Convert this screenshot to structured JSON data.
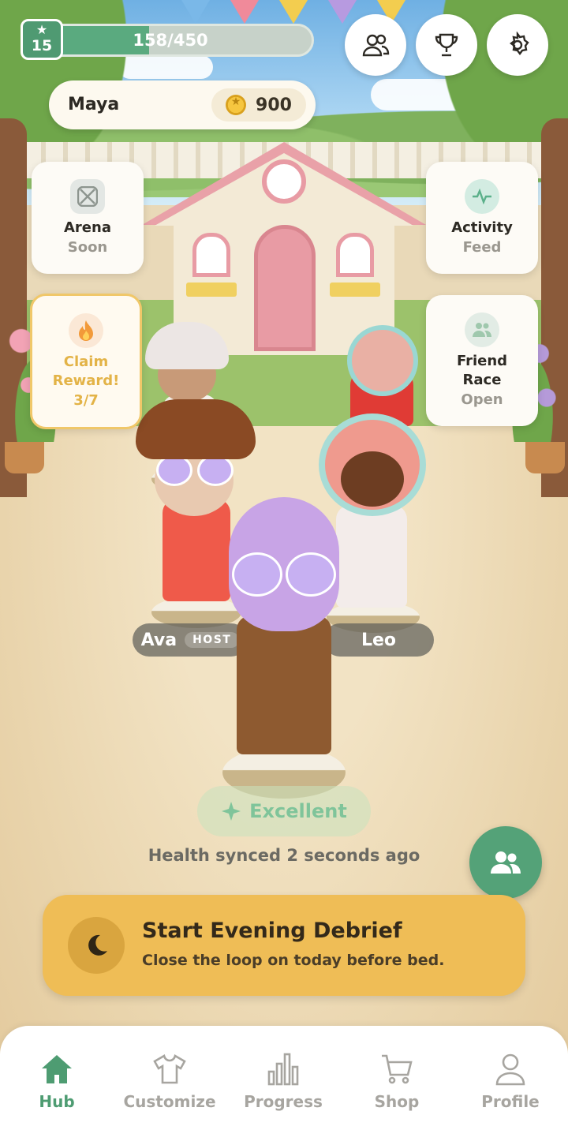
{
  "hud": {
    "level": "15",
    "xp_text": "158/450",
    "xp_progress": 0.351,
    "player_name": "Maya",
    "coins": "900"
  },
  "top_buttons": [
    {
      "icon": "friends-icon"
    },
    {
      "icon": "trophy-icon"
    },
    {
      "icon": "gear-icon"
    }
  ],
  "features": {
    "arena": {
      "title": "Arena",
      "status": "Soon",
      "icon": "crossed-swords-icon"
    },
    "activity": {
      "title": "Activity",
      "status": "Feed",
      "icon": "pulse-icon"
    },
    "reward": {
      "title": "Claim Reward!",
      "progress": "3/7",
      "icon": "flame-icon"
    },
    "friend_race": {
      "title": "Friend Race",
      "status": "Open",
      "icon": "friends-icon"
    }
  },
  "avatars": {
    "left_name": "Ava",
    "left_badge": "HOST",
    "right_name": "Leo"
  },
  "status": {
    "rating": "Excellent",
    "sync": "Health synced 2 seconds ago"
  },
  "debrief": {
    "title": "Start Evening Debrief",
    "subtitle": "Close the loop on today before bed."
  },
  "tabs": [
    {
      "label": "Hub",
      "icon": "home-icon",
      "active": true
    },
    {
      "label": "Customize",
      "icon": "shirt-icon",
      "active": false
    },
    {
      "label": "Progress",
      "icon": "bar-chart-icon",
      "active": false
    },
    {
      "label": "Shop",
      "icon": "cart-icon",
      "active": false
    },
    {
      "label": "Profile",
      "icon": "person-icon",
      "active": false
    }
  ],
  "colors": {
    "accent_green": "#54a278",
    "debrief_yellow": "#efbd56",
    "reward_gold": "#e3b347"
  }
}
